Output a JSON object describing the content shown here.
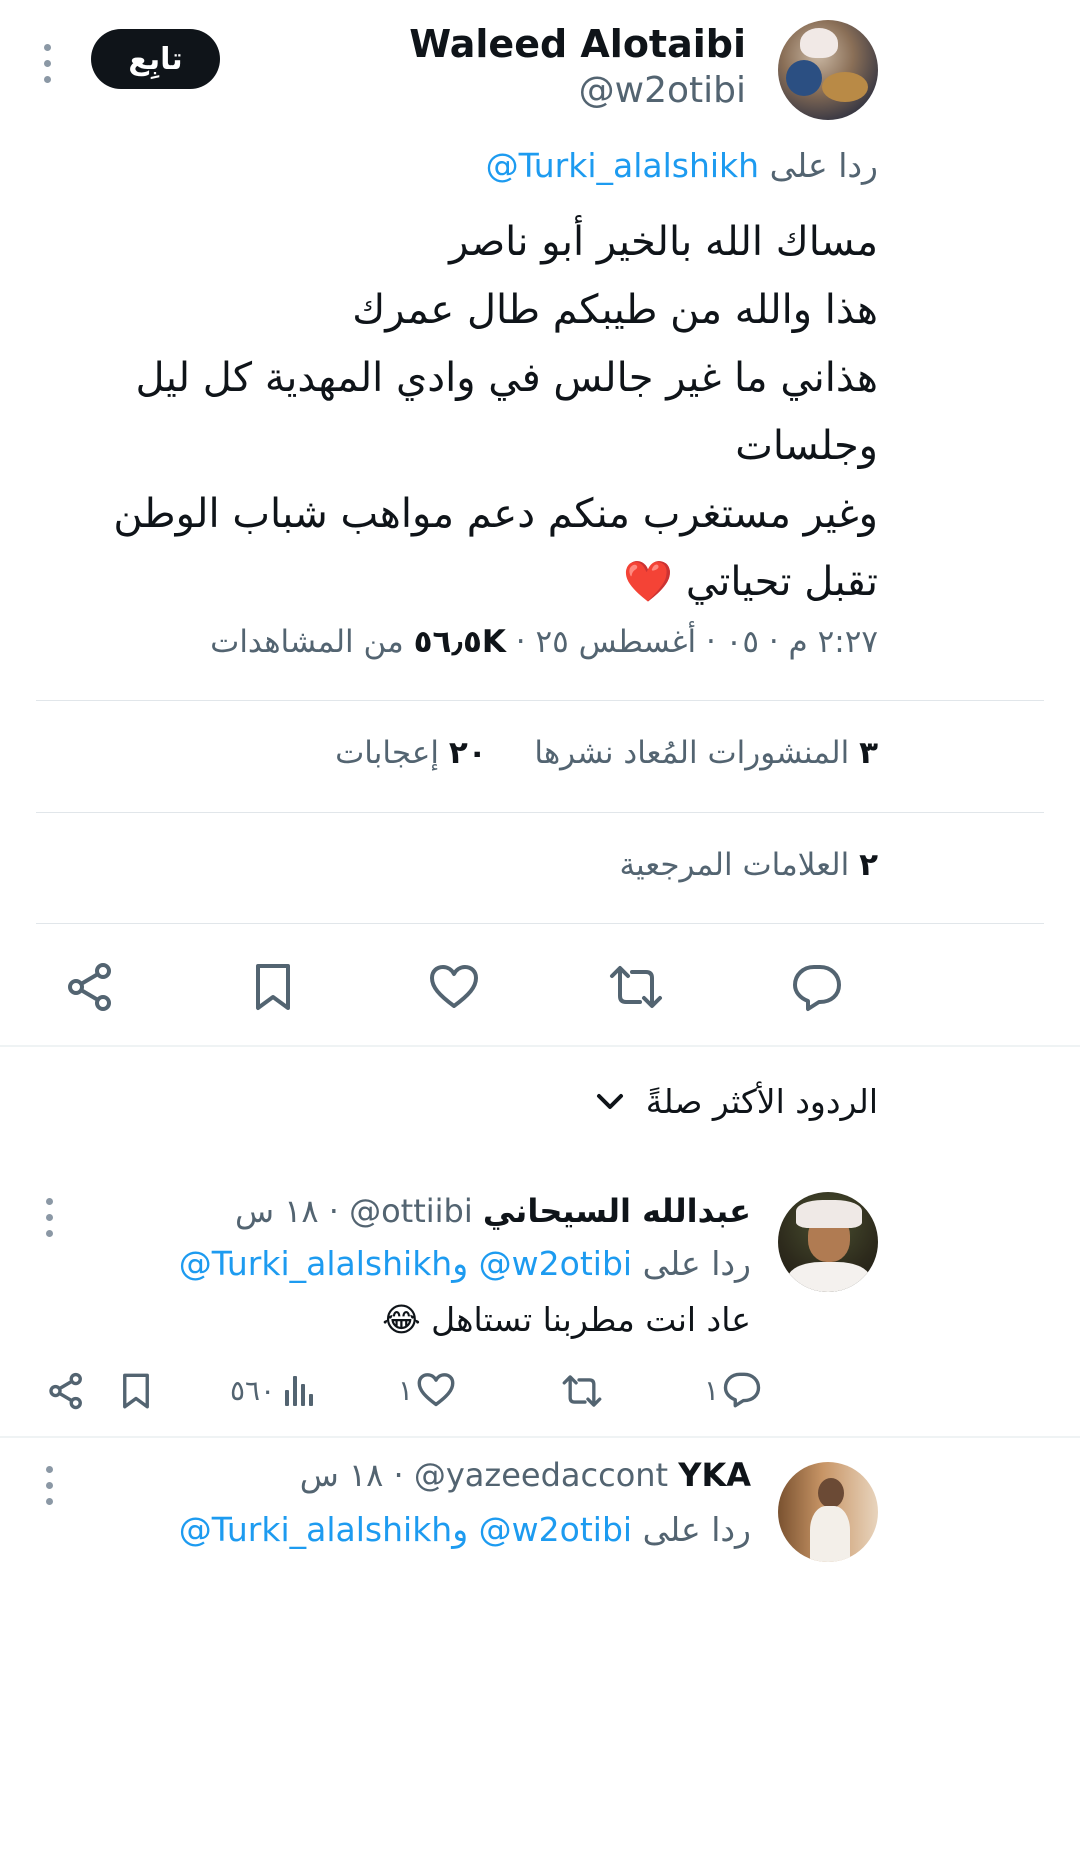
{
  "post": {
    "author_name": "Waleed Alotaibi",
    "author_handle": "@w2otibi",
    "follow_label": "تابِع",
    "reply_to_prefix": "ردا على",
    "reply_to_handle": "@Turki_alalshikh",
    "lines": [
      "مساك الله بالخير أبو ناصر",
      "هذا والله من طيبكم طال عمرك",
      "هذاني ما غير جالس في وادي المهدية كل ليل",
      "وجلسات",
      "وغير مستغرب منكم دعم مواهب شباب الوطن",
      "تقبل تحياتي"
    ],
    "heart_emoji": "❤️",
    "meta_time_date": "٢:٢٧ م · ٠٥ · أغسطس ٢٥ · ",
    "views_count": "٥٦٫٥K",
    "views_label": " من المشاهدات",
    "reposts_count": "٣",
    "reposts_label": "المنشورات المُعاد نشرها",
    "likes_count": "٢٠",
    "likes_label": "إعجابات",
    "bookmarks_count": "٢",
    "bookmarks_label": "العلامات المرجعية"
  },
  "icons": {
    "reply": "reply-icon",
    "repost": "repost-icon",
    "like": "heart-icon",
    "bookmark": "bookmark-icon",
    "share": "share-icon",
    "views": "views-icon",
    "more": "more-icon",
    "chevron": "chevron-down-icon"
  },
  "sort": {
    "label": "الردود الأكثر صلةً"
  },
  "replies": [
    {
      "name": "عبدالله السيحاني",
      "handle": "@ottiibi",
      "time": "· ١٨ س",
      "reply_prefix": "ردا على",
      "mention1": "@w2otibi",
      "joiner": " و",
      "mention2": "@Turki_alalshikh",
      "text": "عاد انت مطربنا تستاهل",
      "emoji": "😂",
      "replies": "١",
      "reposts": "",
      "likes": "١",
      "views": "٥٦٠"
    },
    {
      "name": "YKA",
      "handle": "@yazeedaccont",
      "time": "· ١٨ س",
      "reply_prefix": "ردا على",
      "mention1": "@w2otibi",
      "joiner": " و",
      "mention2": "@Turki_alalshikh"
    }
  ],
  "colors": {
    "accent": "#1d9bf0",
    "text": "#0f1419",
    "muted": "#536471",
    "heart": "#e0245e",
    "follow_bg": "#0f1419"
  }
}
